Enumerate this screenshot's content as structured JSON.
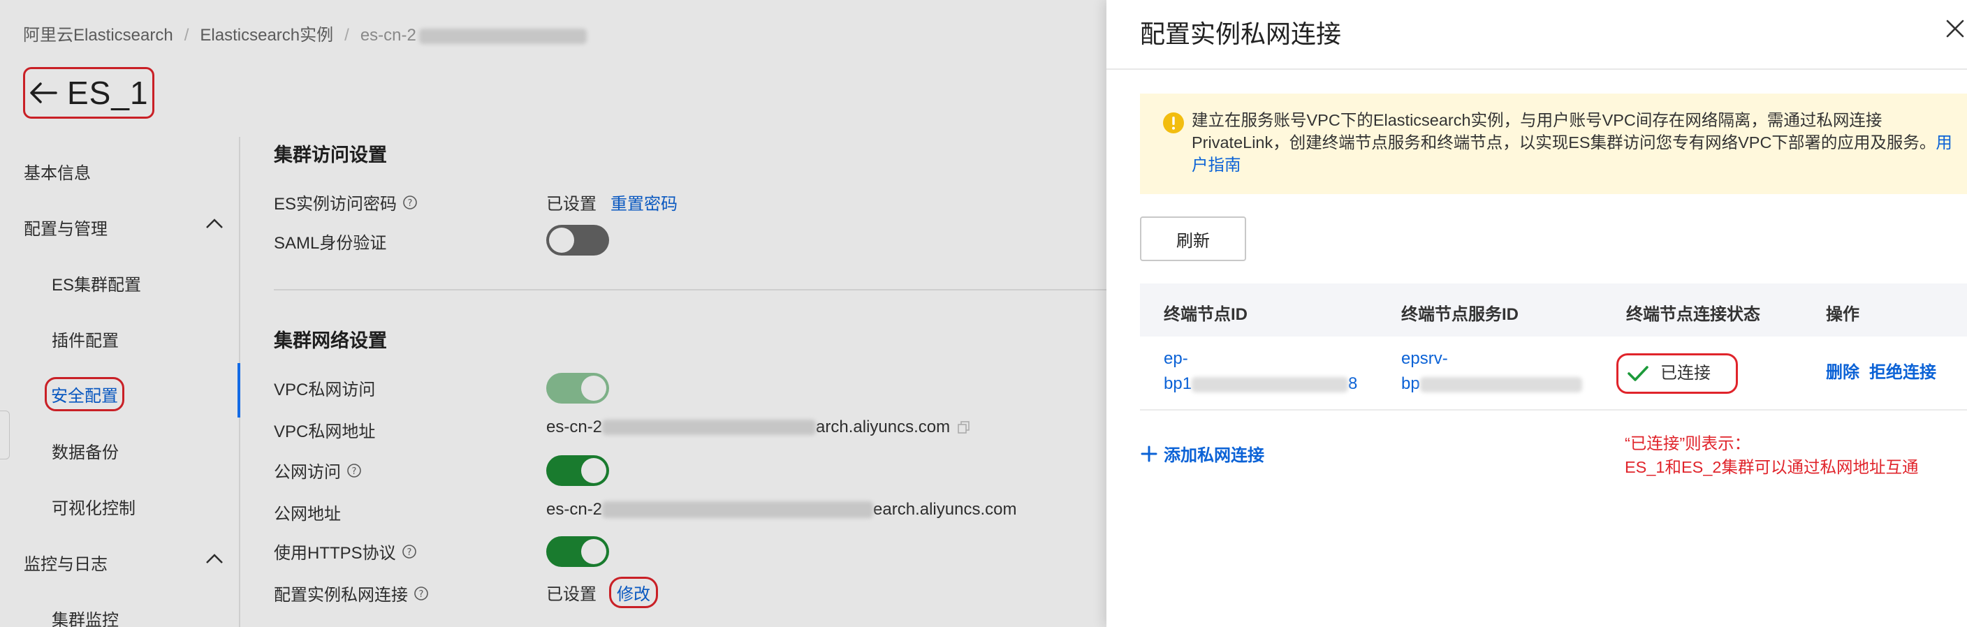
{
  "breadcrumb": {
    "items": [
      "阿里云Elasticsearch",
      "Elasticsearch实例",
      "es-cn-2"
    ]
  },
  "page": {
    "title": "ES_1"
  },
  "sidebar": {
    "items": [
      {
        "label": "基本信息"
      },
      {
        "label": "配置与管理"
      },
      {
        "label": "ES集群配置"
      },
      {
        "label": "插件配置"
      },
      {
        "label": "安全配置"
      },
      {
        "label": "数据备份"
      },
      {
        "label": "可视化控制"
      },
      {
        "label": "监控与日志"
      },
      {
        "label": "集群监控"
      }
    ]
  },
  "cluster_access": {
    "section_title": "集群访问设置",
    "password_label": "ES实例访问密码",
    "password_status": "已设置",
    "reset_password": "重置密码",
    "saml_label": "SAML身份验证",
    "saml_enabled": false
  },
  "cluster_network": {
    "section_title": "集群网络设置",
    "vpc_access_label": "VPC私网访问",
    "vpc_access_enabled": true,
    "vpc_address_label": "VPC私网地址",
    "vpc_address_prefix": "es-cn-2",
    "vpc_address_suffix": "arch.aliyuncs.com",
    "public_access_label": "公网访问",
    "public_access_enabled": true,
    "public_address_label": "公网地址",
    "public_address_prefix": "es-cn-2",
    "public_address_suffix": "earch.aliyuncs.com",
    "https_label": "使用HTTPS协议",
    "https_enabled": true,
    "private_conn_label": "配置实例私网连接",
    "private_conn_status": "已设置",
    "modify": "修改"
  },
  "drawer": {
    "title": "配置实例私网连接",
    "alert_text": "建立在服务账号VPC下的Elasticsearch实例，与用户账号VPC间存在网络隔离，需通过私网连接PrivateLink，创建终端节点服务和终端节点，以实现ES集群访问您专有网络VPC下部署的应用及服务。",
    "alert_link": "用户指南",
    "refresh": "刷新",
    "columns": [
      "终端节点ID",
      "终端节点服务ID",
      "终端节点连接状态",
      "操作"
    ],
    "row": {
      "endpoint_id_line1": "ep-",
      "endpoint_id_line2_prefix": "bp1",
      "endpoint_id_line2_suffix": "8",
      "service_id_line1": "epsrv-",
      "service_id_line2_prefix": "bp",
      "status": "已连接",
      "delete": "删除",
      "reject": "拒绝连接"
    },
    "add_private_connection": "添加私网连接",
    "note_line1": "“已连接”则表示：",
    "note_line2": "ES_1和ES_2集群可以通过私网地址互通"
  },
  "colors": {
    "link": "#0b62d6",
    "highlight_red": "#e0242b",
    "switch_on": "#1c8a34",
    "alert_bg": "#fff8dc",
    "success_green": "#1c9a3a"
  }
}
